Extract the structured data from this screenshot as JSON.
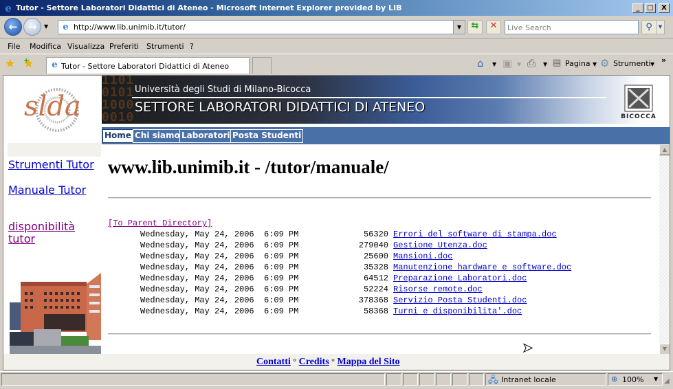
{
  "window": {
    "title": "Tutor - Settore Laboratori Didattici di Ateneo - Microsoft Internet Explorer provided by LIB",
    "controls": {
      "minimize": "_",
      "maximize": "□",
      "close": "X"
    }
  },
  "navbar": {
    "url": "http://www.lib.unimib.it/tutor/",
    "search_placeholder": "Live Search"
  },
  "menu": [
    "File",
    "Modifica",
    "Visualizza",
    "Preferiti",
    "Strumenti",
    "?"
  ],
  "tabs": [
    {
      "label": "Tutor - Settore Laboratori Didattici di Ateneo",
      "active": true
    }
  ],
  "commands": {
    "page": "Pagina",
    "tools": "Strumenti"
  },
  "site": {
    "logo_text": "slda",
    "banner": {
      "binary": "1101\n0101\n1000\n0010",
      "university": "Università degli Studi di Milano-Bicocca",
      "title": "SETTORE LABORATORI DIDATTICI DI ATENEO",
      "emblem_text": "BICOCCA"
    },
    "nav": [
      {
        "label": "Home",
        "active": true
      },
      {
        "label": "Chi siamo",
        "active": false
      },
      {
        "label": "Laboratori",
        "active": false
      },
      {
        "label": "Posta Studenti",
        "active": false
      }
    ],
    "sidebar": [
      {
        "label": "Strumenti Tutor",
        "visited": false
      },
      {
        "label": "Manuale Tutor",
        "visited": false
      },
      {
        "label": "disponibilità tutor",
        "visited": true
      }
    ],
    "footer": [
      {
        "label": "Contatti"
      },
      {
        "label": "Credits"
      },
      {
        "label": "Mappa del Sito"
      }
    ],
    "footer_separator": "°"
  },
  "listing": {
    "heading": "www.lib.unimib.it - /tutor/manuale/",
    "parent_link": "[To Parent Directory]",
    "files": [
      {
        "date": "Wednesday, May 24, 2006  6:09 PM",
        "size": "56320",
        "name": "Errori del software di stampa.doc"
      },
      {
        "date": "Wednesday, May 24, 2006  6:09 PM",
        "size": "279040",
        "name": "Gestione Utenza.doc"
      },
      {
        "date": "Wednesday, May 24, 2006  6:09 PM",
        "size": "25600",
        "name": "Mansioni.doc"
      },
      {
        "date": "Wednesday, May 24, 2006  6:09 PM",
        "size": "35328",
        "name": "Manutenzione hardware e software.doc"
      },
      {
        "date": "Wednesday, May 24, 2006  6:09 PM",
        "size": "64512",
        "name": "Preparazione Laboratori.doc"
      },
      {
        "date": "Wednesday, May 24, 2006  6:09 PM",
        "size": "52224",
        "name": "Risorse remote.doc"
      },
      {
        "date": "Wednesday, May 24, 2006  6:09 PM",
        "size": "378368",
        "name": "Servizio Posta Studenti.doc"
      },
      {
        "date": "Wednesday, May 24, 2006  6:09 PM",
        "size": "58368",
        "name": "Turni e disponibilita'.doc"
      }
    ]
  },
  "statusbar": {
    "zone": "Intranet locale",
    "zoom": "100%"
  },
  "colors": {
    "link": "#0000cc",
    "visited": "#800080",
    "nav_blue": "#4a70a8",
    "logo_orange": "#c8744a"
  }
}
